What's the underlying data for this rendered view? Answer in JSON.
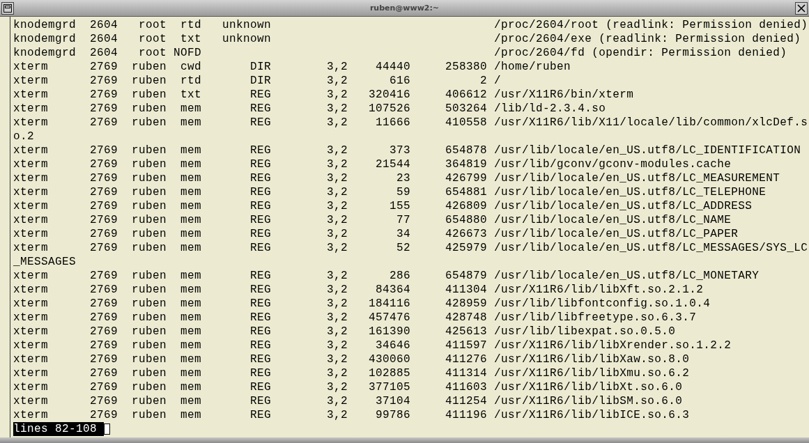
{
  "window": {
    "title": "ruben@www2:~"
  },
  "rows": [
    {
      "kind": "entry",
      "command": "knodemgrd",
      "pid": "2604",
      "user": "root",
      "fd": "rtd",
      "type": "unknown",
      "name": "/proc/2604/root (readlink: Permission denied)"
    },
    {
      "kind": "entry",
      "command": "knodemgrd",
      "pid": "2604",
      "user": "root",
      "fd": "txt",
      "type": "unknown",
      "name": "/proc/2604/exe (readlink: Permission denied)"
    },
    {
      "kind": "entry",
      "command": "knodemgrd",
      "pid": "2604",
      "user": "root",
      "fd": "NOFD",
      "name": "/proc/2604/fd (opendir: Permission denied)"
    },
    {
      "kind": "entry",
      "command": "xterm",
      "pid": "2769",
      "user": "ruben",
      "fd": "cwd",
      "type": "DIR",
      "device": "3,2",
      "size": "44440",
      "node": "258380",
      "name": "/home/ruben"
    },
    {
      "kind": "entry",
      "command": "xterm",
      "pid": "2769",
      "user": "ruben",
      "fd": "rtd",
      "type": "DIR",
      "device": "3,2",
      "size": "616",
      "node": "2",
      "name": "/"
    },
    {
      "kind": "entry",
      "command": "xterm",
      "pid": "2769",
      "user": "ruben",
      "fd": "txt",
      "type": "REG",
      "device": "3,2",
      "size": "320416",
      "node": "406612",
      "name": "/usr/X11R6/bin/xterm"
    },
    {
      "kind": "entry",
      "command": "xterm",
      "pid": "2769",
      "user": "ruben",
      "fd": "mem",
      "type": "REG",
      "device": "3,2",
      "size": "107526",
      "node": "503264",
      "name": "/lib/ld-2.3.4.so"
    },
    {
      "kind": "entry",
      "command": "xterm",
      "pid": "2769",
      "user": "ruben",
      "fd": "mem",
      "type": "REG",
      "device": "3,2",
      "size": "11666",
      "node": "410558",
      "name": "/usr/X11R6/lib/X11/locale/lib/common/xlcDef.s"
    },
    {
      "kind": "wrap",
      "text": "o.2"
    },
    {
      "kind": "entry",
      "command": "xterm",
      "pid": "2769",
      "user": "ruben",
      "fd": "mem",
      "type": "REG",
      "device": "3,2",
      "size": "373",
      "node": "654878",
      "name": "/usr/lib/locale/en_US.utf8/LC_IDENTIFICATION"
    },
    {
      "kind": "entry",
      "command": "xterm",
      "pid": "2769",
      "user": "ruben",
      "fd": "mem",
      "type": "REG",
      "device": "3,2",
      "size": "21544",
      "node": "364819",
      "name": "/usr/lib/gconv/gconv-modules.cache"
    },
    {
      "kind": "entry",
      "command": "xterm",
      "pid": "2769",
      "user": "ruben",
      "fd": "mem",
      "type": "REG",
      "device": "3,2",
      "size": "23",
      "node": "426799",
      "name": "/usr/lib/locale/en_US.utf8/LC_MEASUREMENT"
    },
    {
      "kind": "entry",
      "command": "xterm",
      "pid": "2769",
      "user": "ruben",
      "fd": "mem",
      "type": "REG",
      "device": "3,2",
      "size": "59",
      "node": "654881",
      "name": "/usr/lib/locale/en_US.utf8/LC_TELEPHONE"
    },
    {
      "kind": "entry",
      "command": "xterm",
      "pid": "2769",
      "user": "ruben",
      "fd": "mem",
      "type": "REG",
      "device": "3,2",
      "size": "155",
      "node": "426809",
      "name": "/usr/lib/locale/en_US.utf8/LC_ADDRESS"
    },
    {
      "kind": "entry",
      "command": "xterm",
      "pid": "2769",
      "user": "ruben",
      "fd": "mem",
      "type": "REG",
      "device": "3,2",
      "size": "77",
      "node": "654880",
      "name": "/usr/lib/locale/en_US.utf8/LC_NAME"
    },
    {
      "kind": "entry",
      "command": "xterm",
      "pid": "2769",
      "user": "ruben",
      "fd": "mem",
      "type": "REG",
      "device": "3,2",
      "size": "34",
      "node": "426673",
      "name": "/usr/lib/locale/en_US.utf8/LC_PAPER"
    },
    {
      "kind": "entry",
      "command": "xterm",
      "pid": "2769",
      "user": "ruben",
      "fd": "mem",
      "type": "REG",
      "device": "3,2",
      "size": "52",
      "node": "425979",
      "name": "/usr/lib/locale/en_US.utf8/LC_MESSAGES/SYS_LC"
    },
    {
      "kind": "wrap",
      "text": "_MESSAGES"
    },
    {
      "kind": "entry",
      "command": "xterm",
      "pid": "2769",
      "user": "ruben",
      "fd": "mem",
      "type": "REG",
      "device": "3,2",
      "size": "286",
      "node": "654879",
      "name": "/usr/lib/locale/en_US.utf8/LC_MONETARY"
    },
    {
      "kind": "entry",
      "command": "xterm",
      "pid": "2769",
      "user": "ruben",
      "fd": "mem",
      "type": "REG",
      "device": "3,2",
      "size": "84364",
      "node": "411304",
      "name": "/usr/X11R6/lib/libXft.so.2.1.2"
    },
    {
      "kind": "entry",
      "command": "xterm",
      "pid": "2769",
      "user": "ruben",
      "fd": "mem",
      "type": "REG",
      "device": "3,2",
      "size": "184116",
      "node": "428959",
      "name": "/usr/lib/libfontconfig.so.1.0.4"
    },
    {
      "kind": "entry",
      "command": "xterm",
      "pid": "2769",
      "user": "ruben",
      "fd": "mem",
      "type": "REG",
      "device": "3,2",
      "size": "457476",
      "node": "428748",
      "name": "/usr/lib/libfreetype.so.6.3.7"
    },
    {
      "kind": "entry",
      "command": "xterm",
      "pid": "2769",
      "user": "ruben",
      "fd": "mem",
      "type": "REG",
      "device": "3,2",
      "size": "161390",
      "node": "425613",
      "name": "/usr/lib/libexpat.so.0.5.0"
    },
    {
      "kind": "entry",
      "command": "xterm",
      "pid": "2769",
      "user": "ruben",
      "fd": "mem",
      "type": "REG",
      "device": "3,2",
      "size": "34646",
      "node": "411597",
      "name": "/usr/X11R6/lib/libXrender.so.1.2.2"
    },
    {
      "kind": "entry",
      "command": "xterm",
      "pid": "2769",
      "user": "ruben",
      "fd": "mem",
      "type": "REG",
      "device": "3,2",
      "size": "430060",
      "node": "411276",
      "name": "/usr/X11R6/lib/libXaw.so.8.0"
    },
    {
      "kind": "entry",
      "command": "xterm",
      "pid": "2769",
      "user": "ruben",
      "fd": "mem",
      "type": "REG",
      "device": "3,2",
      "size": "102885",
      "node": "411314",
      "name": "/usr/X11R6/lib/libXmu.so.6.2"
    },
    {
      "kind": "entry",
      "command": "xterm",
      "pid": "2769",
      "user": "ruben",
      "fd": "mem",
      "type": "REG",
      "device": "3,2",
      "size": "377105",
      "node": "411603",
      "name": "/usr/X11R6/lib/libXt.so.6.0"
    },
    {
      "kind": "entry",
      "command": "xterm",
      "pid": "2769",
      "user": "ruben",
      "fd": "mem",
      "type": "REG",
      "device": "3,2",
      "size": "37104",
      "node": "411254",
      "name": "/usr/X11R6/lib/libSM.so.6.0"
    },
    {
      "kind": "entry",
      "command": "xterm",
      "pid": "2769",
      "user": "ruben",
      "fd": "mem",
      "type": "REG",
      "device": "3,2",
      "size": "99786",
      "node": "411196",
      "name": "/usr/X11R6/lib/libICE.so.6.3"
    }
  ],
  "pager_prompt": "lines 82-108"
}
